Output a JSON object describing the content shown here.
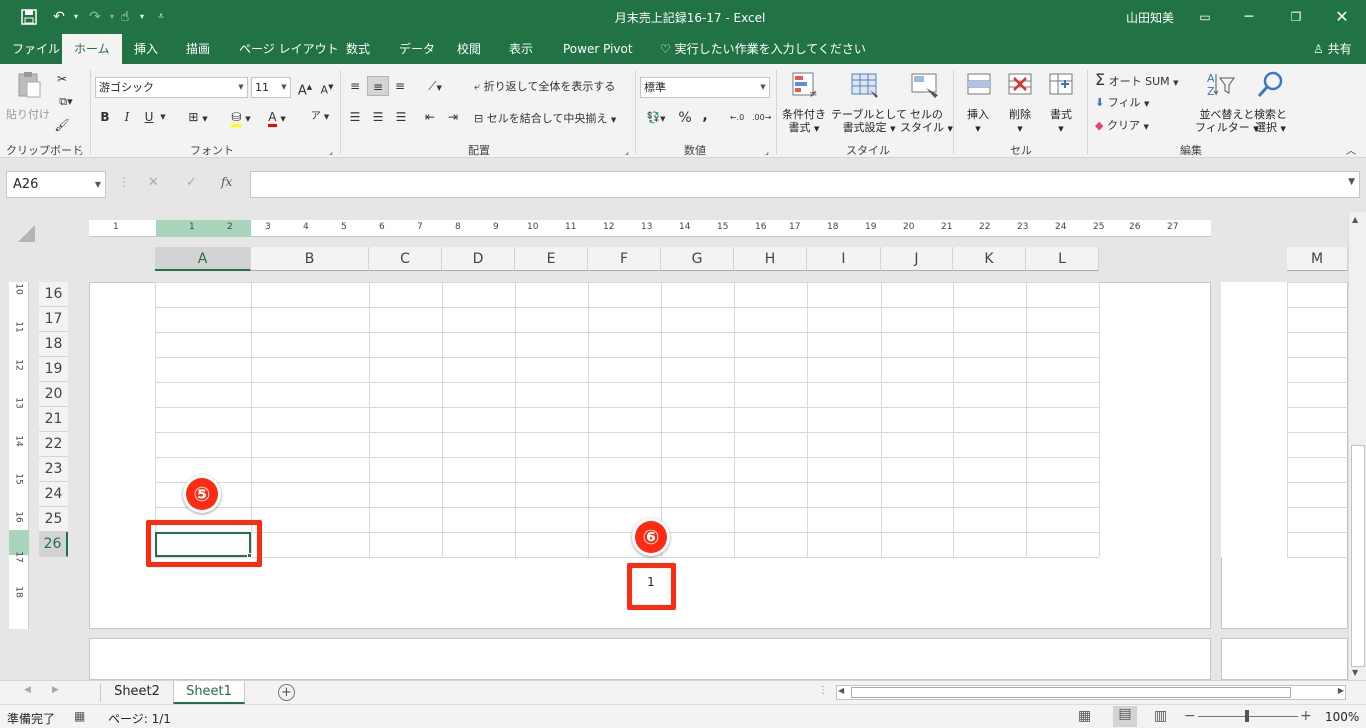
{
  "titlebar": {
    "title": "月末売上記録16-17  -  Excel",
    "user": "山田知美",
    "color": "#217346"
  },
  "tabs": [
    "ファイル",
    "ホーム",
    "挿入",
    "描画",
    "ページ レイアウト",
    "数式",
    "データ",
    "校閲",
    "表示",
    "Power Pivot"
  ],
  "tell_me": "実行したい作業を入力してください",
  "share": "共有",
  "ribbon": {
    "clipboard": {
      "paste": "貼り付け",
      "label": "クリップボード"
    },
    "font": {
      "name": "游ゴシック",
      "size": "11",
      "bold": "B",
      "italic": "I",
      "underline": "U",
      "label": "フォント"
    },
    "alignment": {
      "wrap": "折り返して全体を表示する",
      "merge": "セルを結合して中央揃え",
      "label": "配置"
    },
    "number": {
      "format": "標準",
      "percent": "%",
      "comma": ",",
      "label": "数値"
    },
    "styles": {
      "conditional": [
        "条件付き",
        "書式"
      ],
      "table": [
        "テーブルとして",
        "書式設定"
      ],
      "cell": [
        "セルの",
        "スタイル"
      ],
      "label": "スタイル"
    },
    "cells": {
      "insert": "挿入",
      "delete": "削除",
      "format": "書式",
      "label": "セル"
    },
    "editing": {
      "autosum": "オート SUM",
      "fill": "フィル",
      "clear": "クリア",
      "sort": [
        "並べ替えと",
        "フィルター"
      ],
      "find": [
        "検索と",
        "選択"
      ],
      "label": "編集"
    }
  },
  "formula": {
    "namebox": "A26",
    "cancel": "✕",
    "enter": "✓",
    "fx": "fx",
    "value": ""
  },
  "ruler_numbers": [
    "1",
    "1",
    "2",
    "3",
    "4",
    "5",
    "6",
    "7",
    "8",
    "9",
    "10",
    "11",
    "12",
    "13",
    "14",
    "15",
    "16",
    "17",
    "18",
    "19",
    "20",
    "21",
    "22",
    "23",
    "24",
    "25",
    "26",
    "27"
  ],
  "vruler_numbers": [
    "10",
    "11",
    "12",
    "13",
    "14",
    "15",
    "16",
    "17",
    "18"
  ],
  "columns": [
    "A",
    "B",
    "C",
    "D",
    "E",
    "F",
    "G",
    "H",
    "I",
    "J",
    "K",
    "L",
    "M"
  ],
  "rows": [
    "16",
    "17",
    "18",
    "19",
    "20",
    "21",
    "22",
    "23",
    "24",
    "25",
    "26"
  ],
  "selected_cell": "A26",
  "page_number": "1",
  "annotations": {
    "five": "⑤",
    "six": "⑥",
    "accent": "#ff2a12"
  },
  "sheets": [
    "Sheet2",
    "Sheet1"
  ],
  "active_sheet": "Sheet1",
  "status": {
    "ready": "準備完了",
    "page": "ページ: 1/1",
    "zoom": "100%"
  }
}
